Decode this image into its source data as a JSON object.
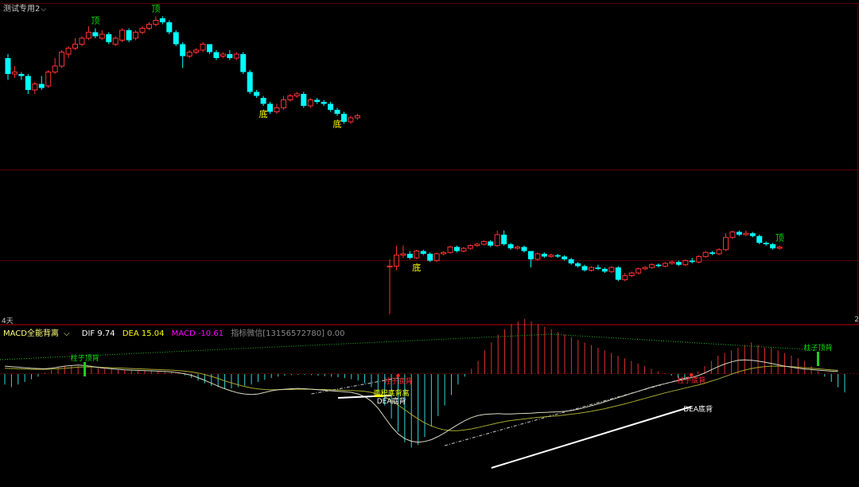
{
  "header": {
    "title": "测试专用2",
    "caret": "⌵",
    "period_left": "4天",
    "period_right": "2"
  },
  "legend": {
    "name": "MACD全能背离",
    "caret": "⌵",
    "dif": "DIF 9.74",
    "dea": "DEA 15.04",
    "macd": "MACD -10.61",
    "extra": "指标微信[13156572780] 0.00"
  },
  "colors": {
    "up": "#ff3232",
    "down": "#00ffff",
    "grid": "#5a0000",
    "dif": "#d8d8c0",
    "dea": "#a8a830",
    "top_label": "#00e000",
    "bottom_label": "#ffff00",
    "divergence_label": "#ff3030",
    "white_label": "#ffffff",
    "legend_dif": "#ffffff",
    "legend_dea": "#ffff00",
    "legend_macd": "#ff00ff",
    "legend_name": "#ffff7f"
  },
  "price_annotations": [
    {
      "text": "顶",
      "kind": "top",
      "index": 13
    },
    {
      "text": "顶",
      "kind": "top",
      "index": 22
    },
    {
      "text": "底",
      "kind": "bottom",
      "index": 38
    },
    {
      "text": "底",
      "kind": "bottom",
      "index": 49
    },
    {
      "text": "底",
      "kind": "bottom",
      "index": 57
    },
    {
      "text": "顶",
      "kind": "top",
      "index": 111
    }
  ],
  "macd_annotations": [
    {
      "text": "柱子顶背",
      "kind": "top"
    },
    {
      "text": "柱子底背",
      "kind": "bottom"
    },
    {
      "text": "面积底背离",
      "kind": "area"
    },
    {
      "text": "DEA底背",
      "kind": "dea"
    },
    {
      "text": "柱子底背",
      "kind": "bottom"
    },
    {
      "text": "DEA底背",
      "kind": "dea"
    },
    {
      "text": "柱子顶背",
      "kind": "top"
    }
  ],
  "chart_data": {
    "type": "candlestick",
    "segments": [
      {
        "candles": [
          [
            60,
            52,
            49,
            62
          ],
          [
            52,
            53,
            50,
            56
          ],
          [
            52,
            51,
            49,
            53
          ],
          [
            51,
            44,
            42,
            52
          ],
          [
            44,
            47,
            42,
            48
          ],
          [
            47,
            45,
            44,
            51
          ],
          [
            46,
            53,
            45,
            54
          ],
          [
            53,
            56,
            52,
            60
          ],
          [
            56,
            63,
            55,
            64
          ],
          [
            62,
            65,
            60,
            66
          ],
          [
            65,
            67,
            64,
            70
          ],
          [
            67,
            70,
            66,
            71
          ],
          [
            70,
            73,
            69,
            76
          ],
          [
            73,
            71,
            70,
            75
          ],
          [
            70,
            72,
            69,
            74
          ],
          [
            72,
            68,
            67,
            73
          ],
          [
            67,
            70,
            66,
            71
          ],
          [
            69,
            74,
            68,
            75
          ],
          [
            74,
            69,
            68,
            75
          ],
          [
            70,
            73,
            69,
            74
          ],
          [
            73,
            75,
            72,
            76
          ],
          [
            75,
            77,
            74,
            78
          ],
          [
            77,
            79,
            76,
            81
          ],
          [
            80,
            78,
            77,
            81
          ],
          [
            78,
            73,
            72,
            79
          ],
          [
            73,
            67,
            66,
            74
          ],
          [
            67,
            61,
            55,
            68
          ],
          [
            61,
            63,
            60,
            64
          ],
          [
            63,
            64,
            62,
            65
          ],
          [
            64,
            67,
            63,
            68
          ],
          [
            67,
            63,
            62,
            67
          ],
          [
            63,
            60,
            59,
            64
          ],
          [
            61,
            62,
            60,
            63
          ],
          [
            62,
            60,
            59,
            64
          ],
          [
            60,
            62,
            59,
            63
          ],
          [
            62,
            53,
            52,
            63
          ],
          [
            53,
            43,
            42,
            54
          ],
          [
            43,
            41,
            40,
            44
          ],
          [
            40,
            37,
            36,
            41
          ],
          [
            37,
            33,
            32,
            38
          ],
          [
            33,
            35,
            32,
            37
          ],
          [
            35,
            39,
            34,
            41
          ],
          [
            39,
            41,
            38,
            42
          ],
          [
            41,
            42,
            40,
            43
          ],
          [
            42,
            36,
            35,
            43
          ],
          [
            36,
            39,
            35,
            40
          ],
          [
            39,
            38,
            37,
            40
          ],
          [
            38,
            37,
            36,
            39
          ],
          [
            37,
            34,
            33,
            38
          ],
          [
            34,
            32,
            31,
            35
          ],
          [
            32,
            28,
            27,
            33
          ],
          [
            28,
            30,
            27,
            31
          ],
          [
            30,
            31,
            29,
            32
          ]
        ]
      },
      {
        "candles": [
          [
            5,
            5,
            -30,
            10
          ],
          [
            5,
            13,
            2,
            20
          ],
          [
            13,
            14,
            11,
            20
          ],
          [
            14,
            11,
            10,
            16
          ],
          [
            11,
            16,
            10,
            17
          ],
          [
            16,
            14,
            13,
            17
          ],
          [
            14,
            9,
            8,
            15
          ],
          [
            9,
            14,
            8,
            15
          ],
          [
            14,
            15,
            13,
            16
          ],
          [
            15,
            19,
            14,
            20
          ],
          [
            19,
            16,
            15,
            20
          ],
          [
            16,
            18,
            15,
            19
          ],
          [
            18,
            20,
            17,
            21
          ],
          [
            20,
            21,
            19,
            22
          ],
          [
            21,
            23,
            20,
            24
          ],
          [
            23,
            20,
            19,
            24
          ],
          [
            20,
            28,
            19,
            31
          ],
          [
            28,
            21,
            20,
            31
          ],
          [
            21,
            18,
            17,
            22
          ],
          [
            18,
            19,
            17,
            20
          ],
          [
            19,
            16,
            15,
            20
          ],
          [
            16,
            10,
            4,
            16
          ],
          [
            10,
            14,
            9,
            15
          ],
          [
            14,
            12,
            11,
            15
          ],
          [
            12,
            13,
            11,
            14
          ],
          [
            13,
            12,
            11,
            14
          ],
          [
            12,
            10,
            9,
            13
          ],
          [
            10,
            7,
            6,
            11
          ],
          [
            7,
            5,
            4,
            8
          ],
          [
            5,
            2,
            1,
            6
          ],
          [
            2,
            4,
            1,
            5
          ],
          [
            4,
            3,
            2,
            6
          ],
          [
            3,
            1,
            0,
            4
          ],
          [
            1,
            4,
            0,
            5
          ],
          [
            4,
            -5,
            -6,
            5
          ],
          [
            -5,
            -2,
            -6,
            0
          ],
          [
            -2,
            0,
            -3,
            1
          ],
          [
            0,
            3,
            -1,
            4
          ],
          [
            3,
            4,
            2,
            5
          ],
          [
            4,
            6,
            3,
            7
          ],
          [
            6,
            5,
            4,
            7
          ],
          [
            5,
            7,
            4,
            8
          ],
          [
            7,
            8,
            6,
            9
          ],
          [
            8,
            6,
            5,
            9
          ],
          [
            6,
            9,
            5,
            10
          ],
          [
            9,
            8,
            7,
            11
          ],
          [
            8,
            12,
            7,
            13
          ],
          [
            12,
            15,
            11,
            16
          ],
          [
            15,
            14,
            13,
            16
          ],
          [
            14,
            17,
            13,
            18
          ],
          [
            17,
            26,
            16,
            29
          ],
          [
            26,
            30,
            25,
            31
          ],
          [
            30,
            28,
            27,
            31
          ],
          [
            28,
            29,
            27,
            31
          ],
          [
            29,
            27,
            26,
            30
          ],
          [
            27,
            22,
            21,
            28
          ],
          [
            22,
            21,
            20,
            23
          ],
          [
            21,
            18,
            17,
            22
          ],
          [
            18,
            19,
            17,
            20
          ]
        ]
      }
    ],
    "macd_hist": [
      -4,
      -5,
      -4,
      -3,
      -2,
      -1,
      0.5,
      1.5,
      2.5,
      3,
      3.2,
      3,
      2.8,
      2.5,
      2.2,
      2,
      1.8,
      1.6,
      1.5,
      1.4,
      1.4,
      1.3,
      1.2,
      1,
      0.8,
      0.5,
      0.2,
      -0.5,
      -1.5,
      -2.5,
      -3.5,
      -4.5,
      -5,
      -5.5,
      -5.5,
      -5,
      -4.5,
      -4,
      -3,
      -2.2,
      -1.5,
      -1,
      -0.6,
      -0.4,
      -0.3,
      -0.3,
      -0.4,
      -0.6,
      -0.8,
      -1,
      -1.2,
      -1.5,
      -2,
      -2.5,
      -3.5,
      -5,
      -8,
      -12,
      -17,
      -22,
      -26,
      -28,
      -27,
      -24,
      -20,
      -16,
      -12,
      -8,
      -4,
      -1,
      2,
      5,
      9,
      12,
      15,
      17,
      19,
      20,
      21,
      20,
      19,
      18,
      17,
      16,
      15,
      14,
      13,
      12,
      11,
      10,
      9,
      8,
      7,
      6,
      5,
      4,
      3,
      2,
      1,
      0.3,
      -0.6,
      -1.4,
      -2,
      -1,
      1,
      3,
      5,
      7,
      8,
      9,
      10,
      11,
      12,
      11,
      10,
      10,
      9,
      8,
      7,
      6,
      5,
      3,
      1,
      -1,
      -3,
      -5,
      -7
    ],
    "dif": [
      3,
      2.8,
      2.6,
      2.4,
      2.2,
      2.1,
      2,
      2.2,
      2.6,
      3,
      3.2,
      3.4,
      3.2,
      2.9,
      2.5,
      2.2,
      2,
      1.8,
      1.6,
      1.5,
      1.4,
      1.3,
      1.2,
      1.1,
      1,
      0.8,
      0.5,
      0.1,
      -0.5,
      -1.4,
      -2.4,
      -3.5,
      -4.6,
      -5.6,
      -6.5,
      -7.2,
      -7.6,
      -7.8,
      -7.6,
      -7,
      -6.4,
      -6,
      -5.8,
      -5.6,
      -5.5,
      -5.6,
      -5.8,
      -6,
      -6.2,
      -6.4,
      -6.6,
      -6.8,
      -7,
      -7.6,
      -8.6,
      -10.4,
      -13,
      -16.5,
      -20,
      -22.8,
      -24.6,
      -25.6,
      -26,
      -25.7,
      -25,
      -23.8,
      -22.4,
      -20.8,
      -19.2,
      -17.8,
      -16.6,
      -15.8,
      -15.4,
      -15.2,
      -15.1,
      -15.2,
      -15.2,
      -15.1,
      -15,
      -14.9,
      -14.7,
      -14.6,
      -14.5,
      -14.4,
      -14.2,
      -13.9,
      -13.4,
      -12.8,
      -12.1,
      -11.4,
      -10.6,
      -9.8,
      -9,
      -8.2,
      -7.4,
      -6.6,
      -5.8,
      -5,
      -4.3,
      -3.7,
      -3.1,
      -2.5,
      -1.9,
      -1.4,
      -0.6,
      0.4,
      1.6,
      2.8,
      3.8,
      4.6,
      5.2,
      5.4,
      5.2,
      4.9,
      4.5,
      4,
      3.5,
      3,
      2.6,
      2.2,
      1.9,
      1.7,
      1.5,
      1.3,
      1.1,
      1
    ],
    "dea": [
      2.2,
      2.1,
      2,
      1.9,
      1.8,
      1.8,
      1.8,
      1.9,
      2,
      2.2,
      2.4,
      2.6,
      2.7,
      2.7,
      2.6,
      2.5,
      2.4,
      2.3,
      2.2,
      2.1,
      2,
      1.9,
      1.8,
      1.7,
      1.6,
      1.5,
      1.3,
      1.1,
      0.8,
      0.4,
      -0.2,
      -0.9,
      -1.7,
      -2.6,
      -3.4,
      -4.1,
      -4.8,
      -5.3,
      -5.7,
      -5.9,
      -6,
      -6,
      -5.9,
      -5.9,
      -5.8,
      -5.8,
      -5.8,
      -5.9,
      -5.9,
      -6,
      -6.1,
      -6.2,
      -6.3,
      -6.4,
      -6.6,
      -7,
      -7.7,
      -8.7,
      -10.1,
      -11.8,
      -13.6,
      -15.4,
      -17.1,
      -18.6,
      -19.8,
      -20.7,
      -21.3,
      -21.6,
      -21.6,
      -21.3,
      -20.9,
      -20.4,
      -19.8,
      -19.2,
      -18.6,
      -18.1,
      -17.7,
      -17.4,
      -17.1,
      -16.8,
      -16.5,
      -16.3,
      -16.1,
      -15.9,
      -15.6,
      -15.3,
      -15,
      -14.6,
      -14.2,
      -13.7,
      -13.2,
      -12.6,
      -12,
      -11.4,
      -10.7,
      -10,
      -9.3,
      -8.6,
      -7.9,
      -7.2,
      -6.6,
      -6,
      -5.4,
      -4.8,
      -4.2,
      -3.5,
      -2.7,
      -1.9,
      -1,
      -0.1,
      0.8,
      1.5,
      2.1,
      2.5,
      2.8,
      3,
      3,
      2.9,
      2.8,
      2.6,
      2.4,
      2.2,
      2,
      1.8,
      1.6,
      1.4
    ]
  }
}
